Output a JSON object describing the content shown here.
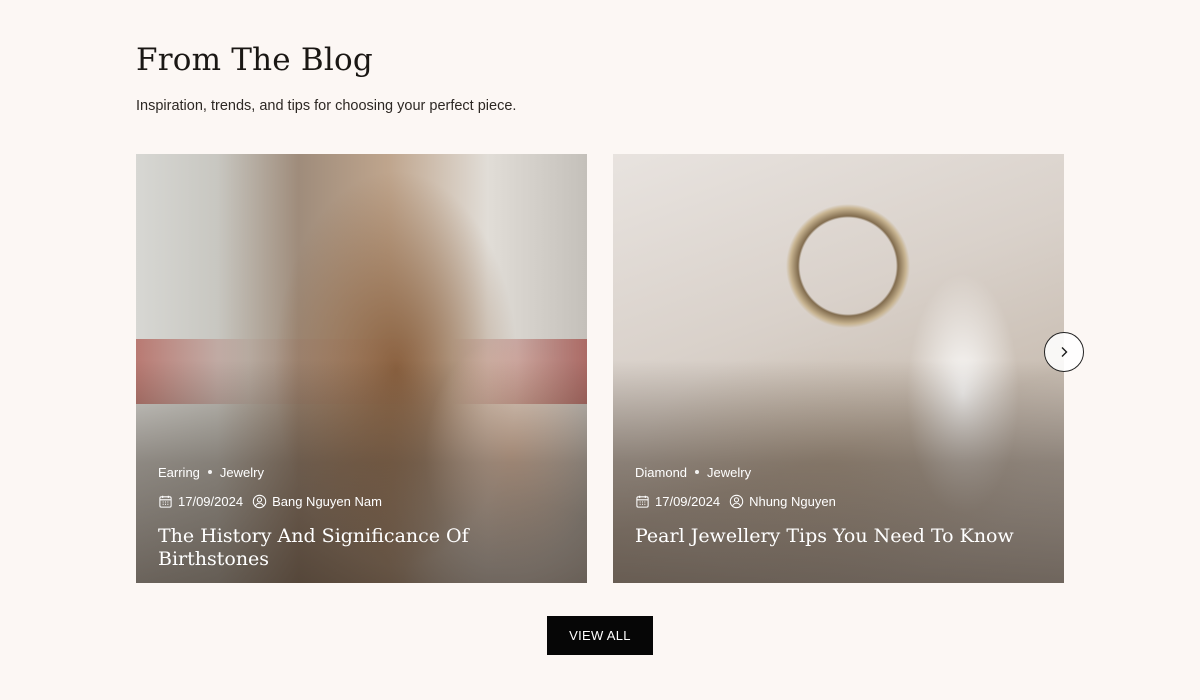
{
  "section": {
    "title": "From The Blog",
    "subtitle": "Inspiration, trends, and tips for choosing your perfect piece."
  },
  "posts": [
    {
      "tags": [
        "Earring",
        "Jewelry"
      ],
      "date": "17/09/2024",
      "author": "Bang Nguyen Nam",
      "title": "The History And Significance Of Birthstones"
    },
    {
      "tags": [
        "Diamond",
        "Jewelry"
      ],
      "date": "17/09/2024",
      "author": "Nhung Nguyen",
      "title": "Pearl Jewellery Tips You Need To Know"
    }
  ],
  "carousel": {
    "next_icon": "chevron-right-icon"
  },
  "actions": {
    "view_all": "VIEW ALL"
  },
  "colors": {
    "background": "#fcf7f4",
    "button_background": "#060606",
    "button_text": "#ffffff"
  }
}
